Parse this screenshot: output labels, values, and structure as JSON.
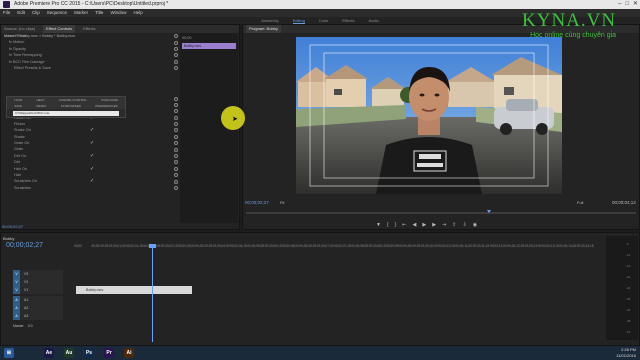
{
  "window": {
    "title": "Adobe Premiere Pro CC 2015 - C:\\Users\\PC\\Desktop\\Untitled.prproj *"
  },
  "menu": [
    "File",
    "Edit",
    "Clip",
    "Sequence",
    "Marker",
    "Title",
    "Window",
    "Help"
  ],
  "workspaces": [
    {
      "label": "Assembly",
      "active": false
    },
    {
      "label": "Editing",
      "active": true
    },
    {
      "label": "Color",
      "active": false
    },
    {
      "label": "Effects",
      "active": false
    },
    {
      "label": "Audio",
      "active": false
    }
  ],
  "left_tabs": [
    "Source: (no clips)",
    "Effect Controls",
    "Effects"
  ],
  "effect_controls": {
    "breadcrumb": "Master * Bobby.mov   >   Bobby * Bobby.mov",
    "clip_label": "Bobby.mov",
    "ruler_time": "00;00",
    "rows": [
      {
        "label": "Video Effects",
        "indent": 0,
        "check": false
      },
      {
        "label": "fx  Motion",
        "indent": 1,
        "check": false
      },
      {
        "label": "fx  Opacity",
        "indent": 1,
        "check": false
      },
      {
        "label": "fx  Time Remapping",
        "indent": 1,
        "check": false
      },
      {
        "label": "fx  BCC Film Damage",
        "indent": 1,
        "check": false
      },
      {
        "label": "Effect Presets & Save",
        "indent": 2,
        "check": false
      },
      {
        "label": "Compare",
        "indent": 2,
        "check": false
      },
      {
        "label": "Color On",
        "indent": 2,
        "check": true
      },
      {
        "label": "Color",
        "indent": 2,
        "check": false
      },
      {
        "label": "Flicker On",
        "indent": 2,
        "check": true
      },
      {
        "label": "Flicker",
        "indent": 2,
        "check": false
      },
      {
        "label": "Shake On",
        "indent": 2,
        "check": true
      },
      {
        "label": "Shake",
        "indent": 2,
        "check": false
      },
      {
        "label": "Grain On",
        "indent": 2,
        "check": true
      },
      {
        "label": "Grain",
        "indent": 2,
        "check": false
      },
      {
        "label": "Dirt On",
        "indent": 2,
        "check": true
      },
      {
        "label": "Dirt",
        "indent": 2,
        "check": false
      },
      {
        "label": "Hair On",
        "indent": 2,
        "check": true
      },
      {
        "label": "Hair",
        "indent": 2,
        "check": false
      },
      {
        "label": "Scratches On",
        "indent": 2,
        "check": true
      },
      {
        "label": "Scratches",
        "indent": 2,
        "check": false
      }
    ],
    "preset_headers": [
      "LOAD",
      "HELP",
      "LICENSE CONTROL",
      "PURCHASE"
    ],
    "preset_headers2": [
      "SAVE",
      "RESET",
      "FX BROWSER",
      "PREFERENCES"
    ],
    "preset_input": "CT:Mapped\\Cult BCC Lite",
    "timecode": "00;00;02;27"
  },
  "program": {
    "tab": "Program: Bobby",
    "timecode": "00;00;02;27",
    "fit": "Fit",
    "resolution": "Full",
    "duration": "00;00;04;12"
  },
  "timeline": {
    "tab": "Bobby",
    "timecode": "00;00;02;27",
    "ruler": [
      "00;00",
      "00;00;00;15",
      "00;00;01;00",
      "00;00;01;15",
      "00;00;02;00",
      "00;00;02;15",
      "00;00;03;00",
      "00;00;03;15",
      "00;00;04;00",
      "00;00;04;15",
      "00;00;05;00",
      "00;00;05;15",
      "00;00;06;00",
      "00;00;06;15",
      "00;00;07;00",
      "00;00;07;15",
      "00;00;08;00",
      "00;00;08;15",
      "00;00;09;00",
      "00;00;09;15",
      "00;00;10;00",
      "00;00;10;15",
      "00;00;11;00",
      "00;00;11;15",
      "00;00;12;00",
      "00;00;12;15",
      "00;00;13;00",
      "00;00;13;15",
      "00;00;14;00",
      "00;00;14;15"
    ],
    "tracks": [
      "V3",
      "V2",
      "V1",
      "A1",
      "A2",
      "A3"
    ],
    "master": "Master",
    "master_value": "0.0",
    "clip": "Bobby.mov"
  },
  "meters": [
    "-6",
    "-12",
    "-18",
    "-24",
    "-30",
    "-36",
    "-42",
    "-48",
    "-54"
  ],
  "taskbar": {
    "icons": [
      {
        "label": "Ae",
        "color": "#1a1a4a"
      },
      {
        "label": "Au",
        "color": "#1f3a2a"
      },
      {
        "label": "Ps",
        "color": "#0f2a4a"
      },
      {
        "label": "Pr",
        "color": "#2a1550"
      },
      {
        "label": "Ai",
        "color": "#4a2a0a"
      }
    ],
    "time": "2:28 PM",
    "date": "11/01/2016"
  },
  "watermark": {
    "brand": "KYNA.VN",
    "tagline": "Học online cùng chuyên gia"
  }
}
